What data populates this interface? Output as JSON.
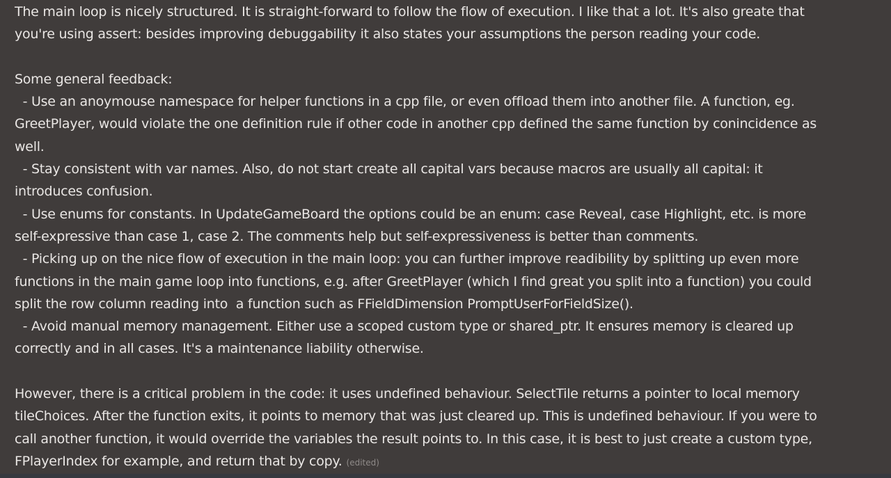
{
  "message": {
    "lines": [
      "The main loop is nicely structured. It is straight-forward to follow the flow of execution. I like that a lot. It's also greate that",
      "you're using assert: besides improving debuggability it also states your assumptions the person reading your code.",
      "",
      "Some general feedback:",
      "  - Use an anoymouse namespace for helper functions in a cpp file, or even offload them into another file. A function, eg.",
      "GreetPlayer, would violate the one definition rule if other code in another cpp defined the same function by conincidence as",
      "well.",
      "  - Stay consistent with var names. Also, do not start create all capital vars because macros are usually all capital: it",
      "introduces confusion.",
      "  - Use enums for constants. In UpdateGameBoard the options could be an enum: case Reveal, case Highlight, etc. is more",
      "self-expressive than case 1, case 2. The comments help but self-expressiveness is better than comments.",
      "  - Picking up on the nice flow of execution in the main loop: you can further improve readibility by splitting up even more",
      "functions in the main game loop into functions, e.g. after GreetPlayer (which I find great you split into a function) you could",
      "split the row column reading into  a function such as FFieldDimension PromptUserForFieldSize().",
      "  - Avoid manual memory management. Either use a scoped custom type or shared_ptr. It ensures memory is cleared up",
      "correctly and in all cases. It's a maintenance liability otherwise.",
      "",
      "However, there is a critical problem in the code: it uses undefined behaviour. SelectTile returns a pointer to local memory",
      "tileChoices. After the function exits, it points to memory that was just cleared up. This is undefined behaviour. If you were to",
      "call another function, it would override the variables the result points to. In this case, it is best to just create a custom type,",
      "FPlayerIndex for example, and return that by copy."
    ],
    "edited_label": "(edited)"
  }
}
